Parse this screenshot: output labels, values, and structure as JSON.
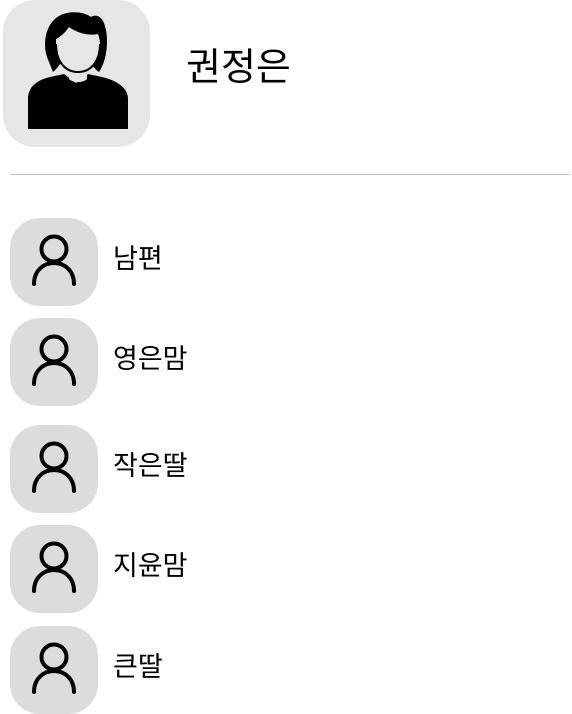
{
  "profile": {
    "name": "권정은",
    "avatar_icon": "female-user-icon",
    "avatar_bg": "#e6e6e6"
  },
  "contacts": [
    {
      "label": "남편",
      "icon": "user-outline-icon"
    },
    {
      "label": "영은맘",
      "icon": "user-outline-icon"
    },
    {
      "label": "작은딸",
      "icon": "user-outline-icon"
    },
    {
      "label": "지윤맘",
      "icon": "user-outline-icon"
    },
    {
      "label": "큰딸",
      "icon": "user-outline-icon"
    }
  ],
  "colors": {
    "avatar_bg": "#dcdcdc",
    "divider": "#bdbdbd",
    "text": "#000000",
    "background": "#ffffff"
  }
}
